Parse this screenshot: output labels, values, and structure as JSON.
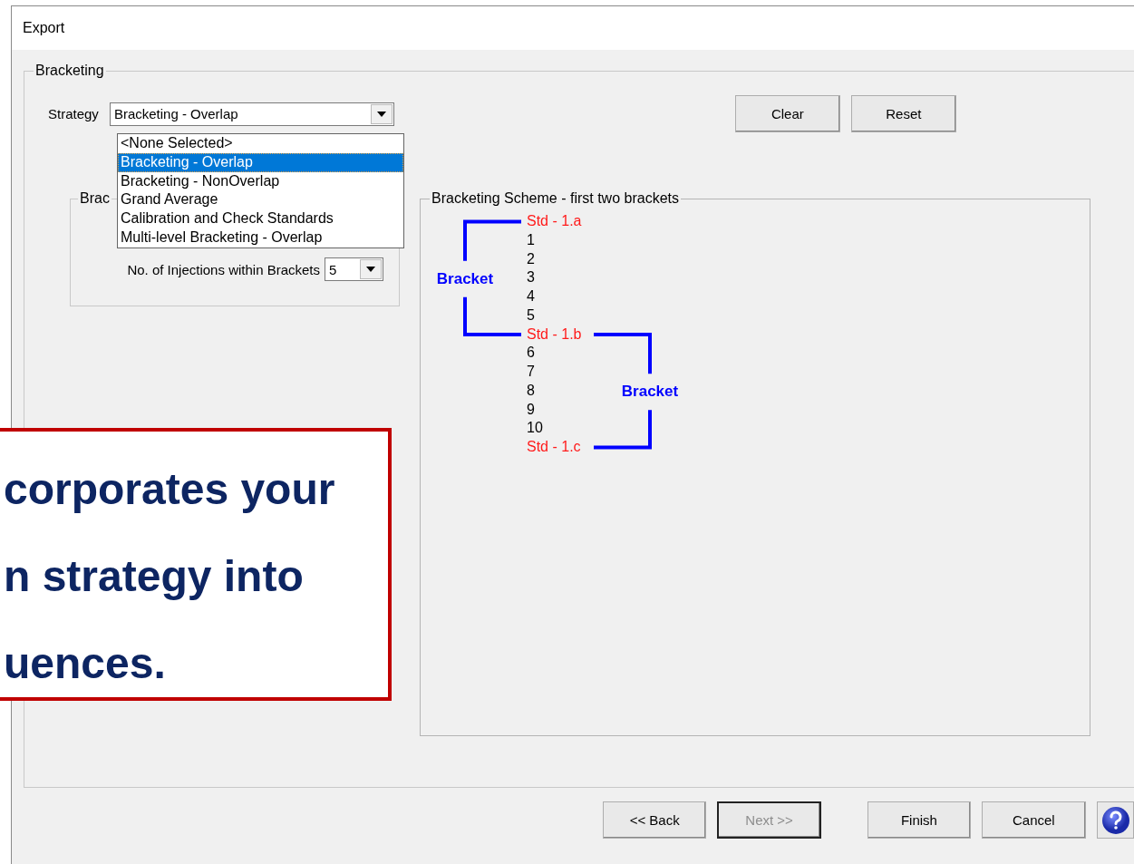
{
  "window": {
    "title": "Export"
  },
  "group": {
    "title": "Bracketing",
    "strategy": {
      "label": "Strategy",
      "value": "Bracketing - Overlap",
      "expanded": true,
      "options": [
        {
          "label": "<None Selected>",
          "selected": false
        },
        {
          "label": "Bracketing - Overlap",
          "selected": true
        },
        {
          "label": "Bracketing - NonOverlap",
          "selected": false
        },
        {
          "label": "Grand Average",
          "selected": false
        },
        {
          "label": "Calibration and Check Standards",
          "selected": false
        },
        {
          "label": "Multi-level Bracketing - Overlap",
          "selected": false
        }
      ]
    },
    "buttons": [
      {
        "label": "Clear"
      },
      {
        "label": "Reset"
      }
    ],
    "settings_group": {
      "title": "Brac",
      "injections": {
        "label": "No. of Injections within Brackets",
        "value": "5"
      }
    },
    "scheme": {
      "title": "Bracketing Scheme - first two brackets",
      "rows": [
        {
          "text": "Std - 1.a",
          "kind": "standard"
        },
        {
          "text": "1",
          "kind": "injection"
        },
        {
          "text": "2",
          "kind": "injection"
        },
        {
          "text": "3",
          "kind": "injection"
        },
        {
          "text": "4",
          "kind": "injection"
        },
        {
          "text": "5",
          "kind": "injection"
        },
        {
          "text": "Std - 1.b",
          "kind": "standard"
        },
        {
          "text": "6",
          "kind": "injection"
        },
        {
          "text": "7",
          "kind": "injection"
        },
        {
          "text": "8",
          "kind": "injection"
        },
        {
          "text": "9",
          "kind": "injection"
        },
        {
          "text": "10",
          "kind": "injection"
        },
        {
          "text": "Std - 1.c",
          "kind": "standard"
        }
      ],
      "brackets": [
        {
          "label": "Bracket"
        },
        {
          "label": "Bracket"
        }
      ]
    }
  },
  "nav_buttons": [
    {
      "label": "<< Back",
      "disabled": false,
      "default": false
    },
    {
      "label": "Next >>",
      "disabled": true,
      "default": true
    },
    {
      "label": "Finish",
      "disabled": false,
      "default": false
    },
    {
      "label": "Cancel",
      "disabled": false,
      "default": false
    }
  ],
  "callout": {
    "lines": [
      "corporates your",
      "n strategy into",
      "uences."
    ]
  }
}
